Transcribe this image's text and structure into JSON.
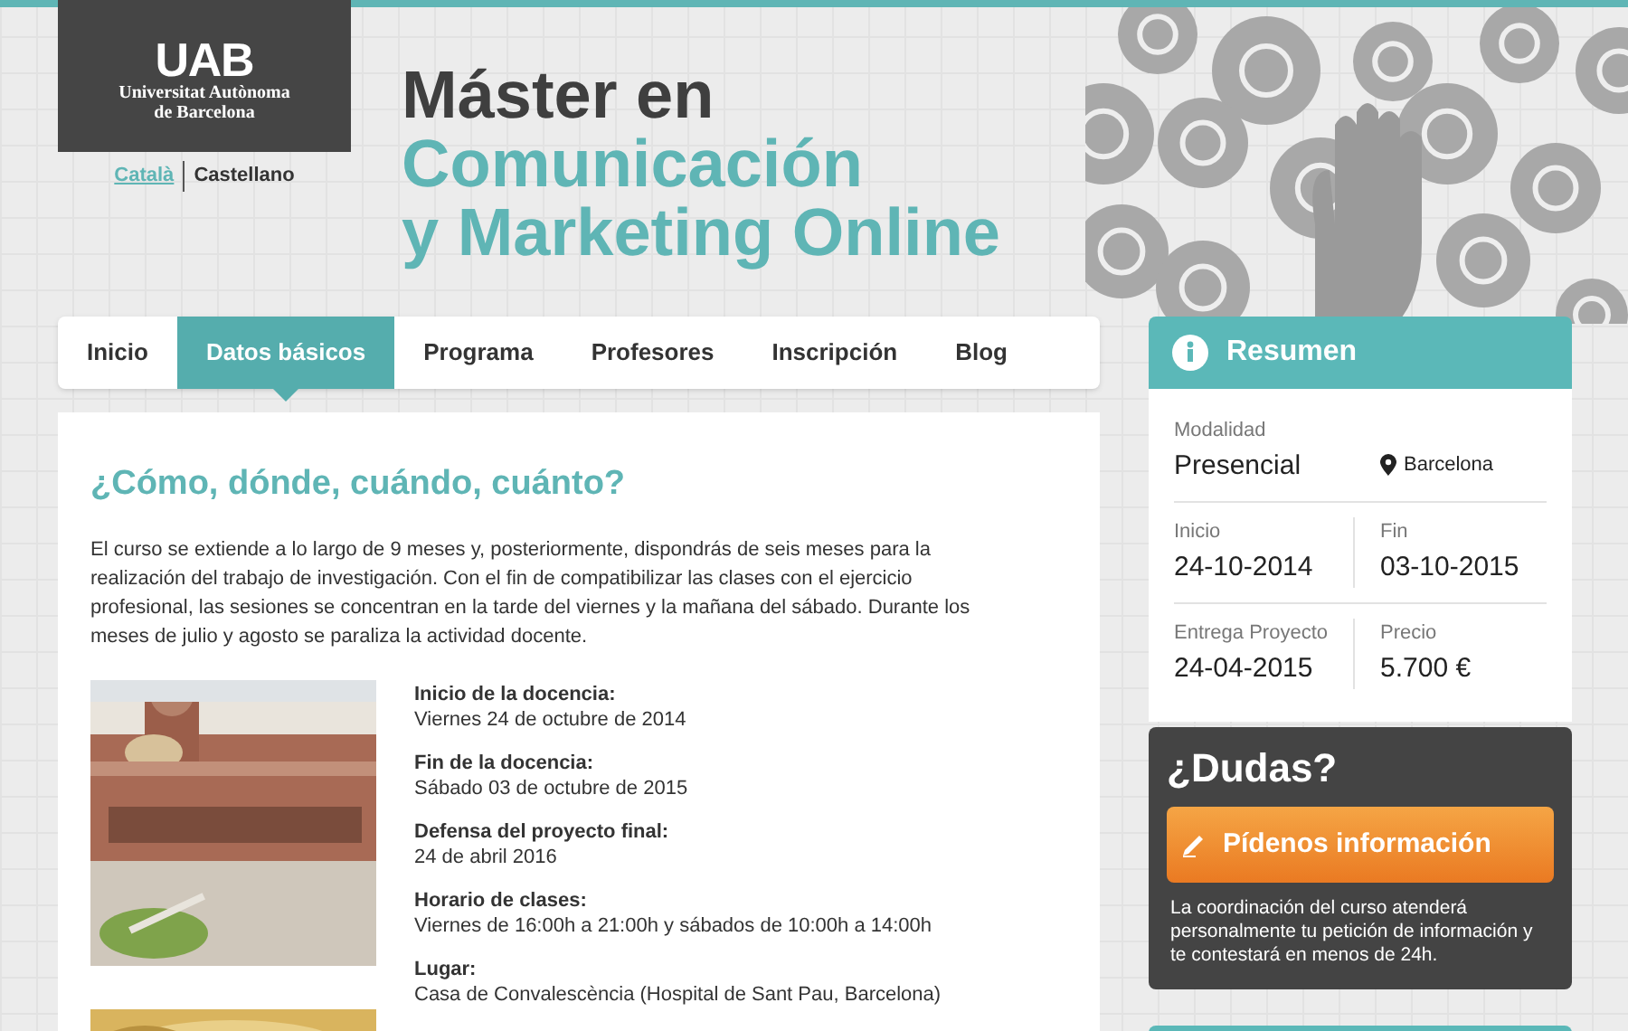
{
  "header": {
    "logo": {
      "mark": "UAB",
      "name": "Universitat Autònoma",
      "city": "de Barcelona"
    },
    "languages": [
      {
        "label": "Català",
        "selected": false
      },
      {
        "label": "Castellano",
        "selected": true
      }
    ],
    "title_lines": [
      "Máster en",
      "Comunicación",
      "y Marketing Online"
    ]
  },
  "tabs": [
    {
      "label": "Inicio",
      "selected": false
    },
    {
      "label": "Datos básicos",
      "selected": true
    },
    {
      "label": "Programa",
      "selected": false
    },
    {
      "label": "Profesores",
      "selected": false
    },
    {
      "label": "Inscripción",
      "selected": false
    },
    {
      "label": "Blog",
      "selected": false
    }
  ],
  "content": {
    "heading": "¿Cómo, dónde, cuándo, cuánto?",
    "intro": "El curso se extiende a lo largo de 9 meses y, posteriormente, dispondrás de seis meses para la realización del trabajo de investigación. Con el fin de compatibilizar las clases con el ejercicio profesional, las sesiones se concentran en la tarde del viernes y la mañana del sábado. Durante los meses de julio y agosto se paraliza la actividad docente.",
    "details": [
      {
        "label": "Inicio de la docencia:",
        "value": "Viernes 24 de octubre de 2014"
      },
      {
        "label": "Fin de la docencia:",
        "value": "Sábado 03 de octubre de 2015"
      },
      {
        "label": "Defensa del proyecto final:",
        "value": "24 de abril 2016"
      },
      {
        "label": "Horario de clases:",
        "value": "Viernes de 16:00h a 21:00h y sábados de 10:00h a 14:00h"
      },
      {
        "label": "Lugar:",
        "value": "Casa de Convalescència (Hospital de Sant Pau, Barcelona)"
      }
    ]
  },
  "summary": {
    "title": "Resumen",
    "modality": {
      "label": "Modalidad",
      "value": "Presencial"
    },
    "location": "Barcelona",
    "pairs": [
      {
        "label": "Inicio",
        "value": "24-10-2014"
      },
      {
        "label": "Fin",
        "value": "03-10-2015"
      },
      {
        "label": "Entrega Proyecto",
        "value": "24-04-2015"
      },
      {
        "label": "Precio",
        "value": "5.700 €"
      }
    ]
  },
  "doubts": {
    "title": "¿Dudas?",
    "button": "Pídenos información",
    "text": "La coordinación del curso atenderá personalmente tu petición de información y te contestará en menos de 24h."
  }
}
